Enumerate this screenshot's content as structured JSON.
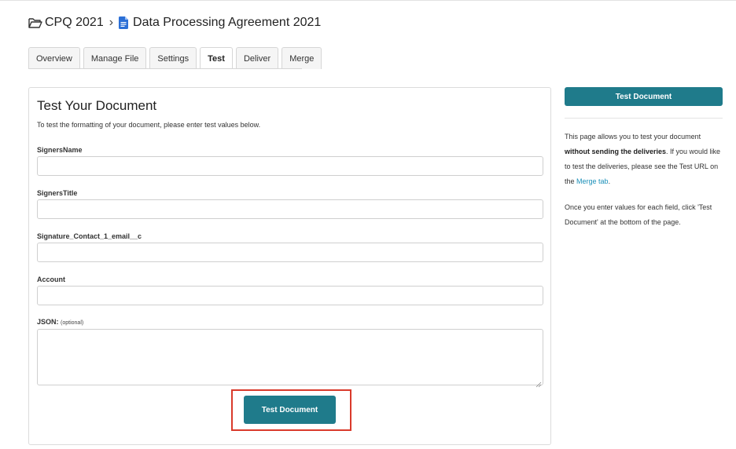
{
  "breadcrumb": {
    "root": "CPQ 2021",
    "separator": "›",
    "document": "Data Processing Agreement 2021",
    "folder_icon": "folder-open-icon",
    "doc_icon": "google-doc-icon",
    "doc_icon_color": "#2b6fd6"
  },
  "tabs": [
    {
      "label": "Overview",
      "active": false
    },
    {
      "label": "Manage File",
      "active": false
    },
    {
      "label": "Settings",
      "active": false
    },
    {
      "label": "Test",
      "active": true
    },
    {
      "label": "Deliver",
      "active": false
    },
    {
      "label": "Merge",
      "active": false
    }
  ],
  "form": {
    "title": "Test Your Document",
    "description": "To test the formatting of your document, please enter test values below.",
    "fields": [
      {
        "label": "SignersName",
        "value": ""
      },
      {
        "label": "SignersTitle",
        "value": ""
      },
      {
        "label": "Signature_Contact_1_email__c",
        "value": ""
      },
      {
        "label": "Account",
        "value": ""
      }
    ],
    "json_label": "JSON:",
    "json_optional": "(optional)",
    "json_value": "",
    "submit_label": "Test Document"
  },
  "sidebar": {
    "button_label": "Test Document",
    "p1_before": "This page allows you to test your document",
    "p1_bold": "without sending the deliveries",
    "p1_mid": ". If you would like to test the deliveries, please see the Test URL on the",
    "p1_link": "Merge tab",
    "p1_end": ".",
    "p2": "Once you enter values for each field, click 'Test Document' at the bottom of the page."
  },
  "colors": {
    "accent": "#1f7b8b",
    "highlight": "#d93a2b",
    "link": "#1a8fb8"
  }
}
